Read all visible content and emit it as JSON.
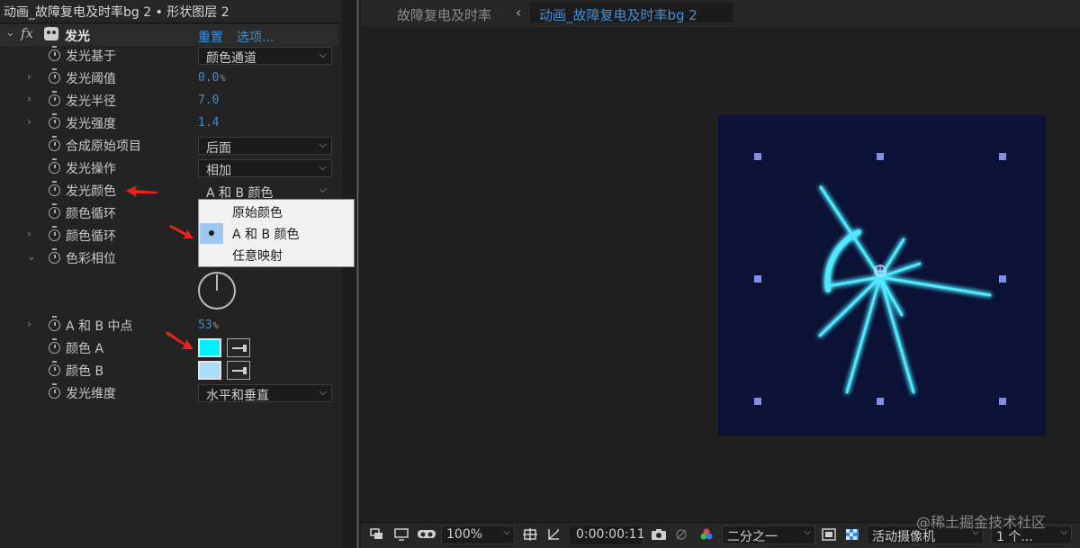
{
  "effects_panel": {
    "title": "动画_故障复电及时率bg 2 • 形状图层 2",
    "effect": {
      "fx_label": "fx",
      "name": "发光",
      "reset_label": "重置",
      "options_label": "选项..."
    },
    "properties": [
      {
        "label": "发光基于",
        "kind": "dropdown",
        "value": "颜色通道"
      },
      {
        "label": "发光阈值",
        "kind": "number",
        "value": "0.0",
        "unit": "%"
      },
      {
        "label": "发光半径",
        "kind": "number",
        "value": "7.0"
      },
      {
        "label": "发光强度",
        "kind": "number",
        "value": "1.4"
      },
      {
        "label": "合成原始项目",
        "kind": "dropdown",
        "value": "后面"
      },
      {
        "label": "发光操作",
        "kind": "dropdown",
        "value": "相加"
      },
      {
        "label": "发光颜色",
        "kind": "dropdown",
        "value": "A 和 B 颜色"
      },
      {
        "label": "颜色循环",
        "kind": "static"
      },
      {
        "label": "颜色循环",
        "kind": "static"
      },
      {
        "label": "色彩相位",
        "kind": "dial"
      },
      {
        "label": "A 和 B 中点",
        "kind": "number",
        "value": "53",
        "unit": "%"
      },
      {
        "label": "颜色 A",
        "kind": "color",
        "color": "#00f0ff"
      },
      {
        "label": "颜色 B",
        "kind": "color",
        "color": "#a9dcff"
      },
      {
        "label": "发光维度",
        "kind": "dropdown",
        "value": "水平和垂直"
      }
    ],
    "color_menu": {
      "items": [
        "原始颜色",
        "A 和 B 颜色",
        "任意映射"
      ],
      "selected": "A 和 B 颜色"
    }
  },
  "composition": {
    "breadcrumb_parent": "故障复电及时率",
    "breadcrumb_separator": "‹",
    "active_tab": "动画_故障复电及时率bg 2",
    "canvas_bg": "#0b1236",
    "glow_color": "#50e8ff",
    "handle_color": "#7f8ee6"
  },
  "toolbar": {
    "zoom": "100%",
    "timecode": "0:00:00:11",
    "resolution": "二分之一",
    "camera": "活动摄像机",
    "views": "1 个..."
  },
  "watermark": "@稀土掘金技术社区",
  "colors": {
    "accent_blue": "#3e8ed8",
    "arrow_red": "#e8241c"
  }
}
